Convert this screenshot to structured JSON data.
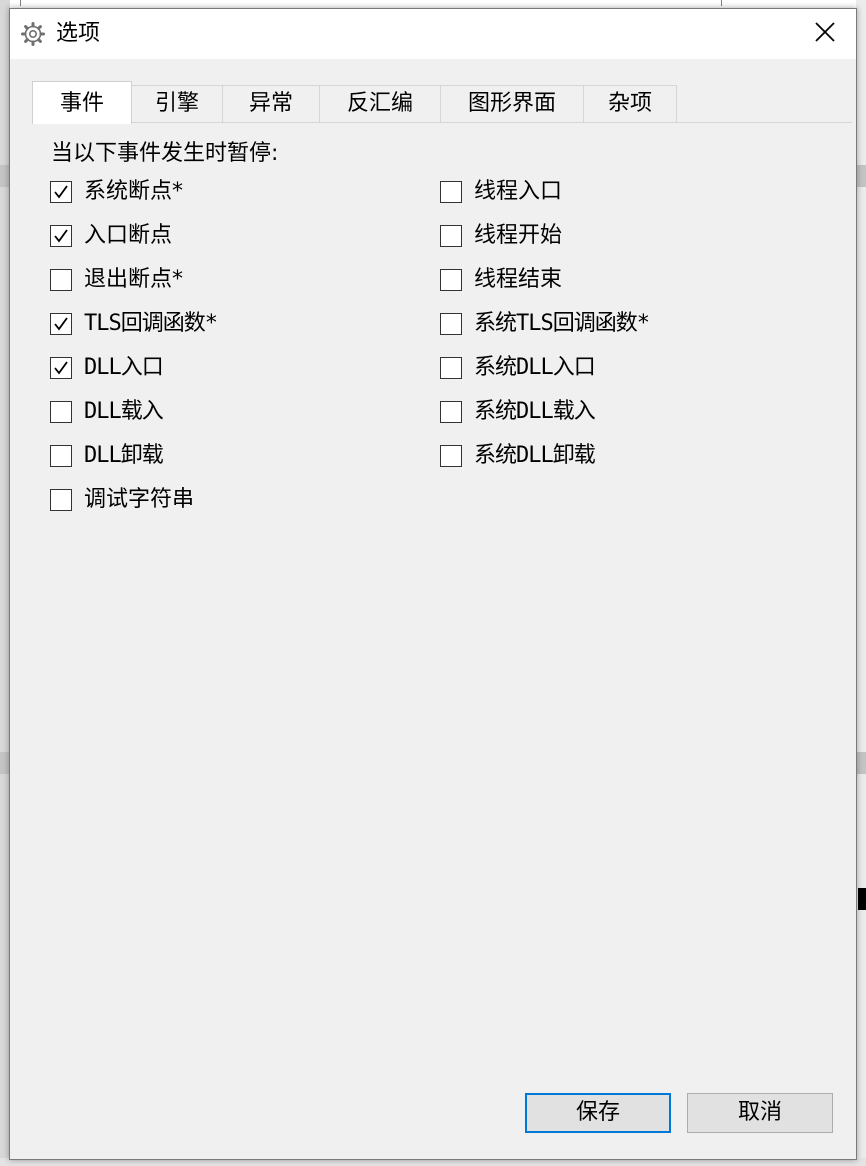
{
  "window": {
    "title": "选项",
    "title_icon": "gear-icon",
    "close_icon": "close-icon"
  },
  "tabs": [
    {
      "label": "事件",
      "active": true
    },
    {
      "label": "引擎",
      "active": false
    },
    {
      "label": "异常",
      "active": false
    },
    {
      "label": "反汇编",
      "active": false
    },
    {
      "label": "图形界面",
      "active": false
    },
    {
      "label": "杂项",
      "active": false
    }
  ],
  "events": {
    "heading": "当以下事件发生时暂停:",
    "left": [
      {
        "label": "系统断点*",
        "checked": true
      },
      {
        "label": "入口断点",
        "checked": true
      },
      {
        "label": "退出断点*",
        "checked": false
      },
      {
        "label": "TLS回调函数*",
        "checked": true
      },
      {
        "label": "DLL入口",
        "checked": true
      },
      {
        "label": "DLL载入",
        "checked": false
      },
      {
        "label": "DLL卸载",
        "checked": false
      },
      {
        "label": "调试字符串",
        "checked": false
      }
    ],
    "right": [
      {
        "label": "线程入口",
        "checked": false
      },
      {
        "label": "线程开始",
        "checked": false
      },
      {
        "label": "线程结束",
        "checked": false
      },
      {
        "label": "系统TLS回调函数*",
        "checked": false
      },
      {
        "label": "系统DLL入口",
        "checked": false
      },
      {
        "label": "系统DLL载入",
        "checked": false
      },
      {
        "label": "系统DLL卸载",
        "checked": false
      }
    ]
  },
  "buttons": {
    "save_label": "保存",
    "cancel_label": "取消"
  },
  "colors": {
    "dialog_bg": "#f0f0f0",
    "title_bg": "#ffffff",
    "default_button_border": "#0078d7"
  }
}
